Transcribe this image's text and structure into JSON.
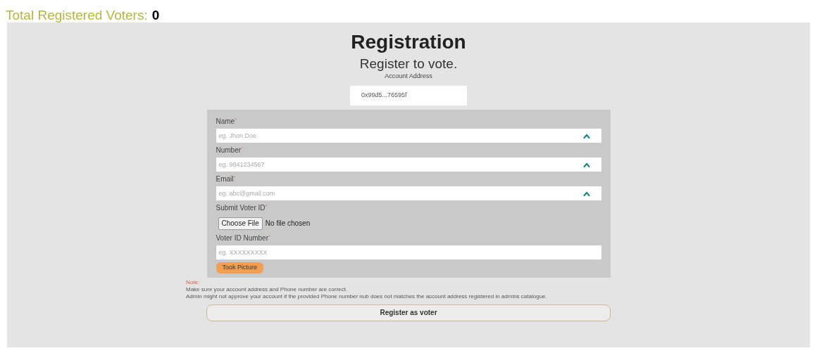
{
  "header": {
    "label": "Total Registered Voters:",
    "count": "0"
  },
  "title": "Registration",
  "subtitle": "Register to vote.",
  "account": {
    "label": "Account Address",
    "value": "0x99d5...76595f"
  },
  "fields": [
    {
      "kind": "text",
      "label": "Name",
      "mark": "*",
      "placeholder": "eg. Jhon Doe",
      "icon": true
    },
    {
      "kind": "text",
      "label": "Number",
      "mark": "*",
      "placeholder": "eg. 9841234567",
      "icon": true
    },
    {
      "kind": "text",
      "label": "Email",
      "mark": "*",
      "placeholder": "eg. abc@gmail.com",
      "icon": true
    },
    {
      "kind": "file",
      "label": "Submit Voter ID",
      "mark": "*",
      "button": "Choose File",
      "status": "No file chosen"
    },
    {
      "kind": "text",
      "label": "Voter ID Number",
      "mark": "*",
      "placeholder": "eg. XXXXXXXXX",
      "icon": false
    }
  ],
  "picture_button": "Took Picture",
  "note": {
    "label": "Note:",
    "lines": [
      "Make sure your account address and Phone number are correct.",
      "Admin might not approve your account if the provided Phone number nub does not matches the account address registered in admins catalogue."
    ]
  },
  "submit": "Register as voter"
}
